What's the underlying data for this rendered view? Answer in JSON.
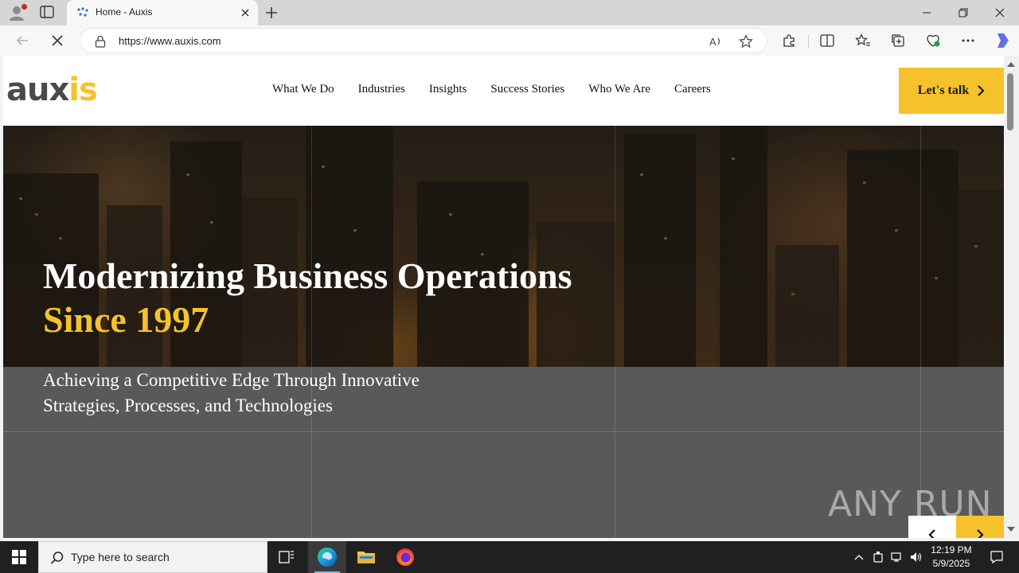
{
  "browser": {
    "tab": {
      "title": "Home - Auxis"
    },
    "address": {
      "url": "https://www.auxis.com"
    }
  },
  "site": {
    "logo": {
      "part1": "aux",
      "part2": "is"
    },
    "nav": [
      "What We Do",
      "Industries",
      "Insights",
      "Success Stories",
      "Who We Are",
      "Careers"
    ],
    "cta_label": "Let's talk",
    "hero": {
      "headline": "Modernizing Business Operations",
      "headline_accent": "Since 1997",
      "subheadline": "Achieving a Competitive Edge Through Innovative Strategies, Processes, and Technologies"
    }
  },
  "watermark": {
    "text": "ANY RUN"
  },
  "taskbar": {
    "search_placeholder": "Type here to search",
    "time": "12:19 PM",
    "date": "5/9/2025"
  },
  "colors": {
    "brand_yellow": "#f5c22b",
    "logo_gray": "#4a4a4a",
    "taskbar": "#202020"
  }
}
